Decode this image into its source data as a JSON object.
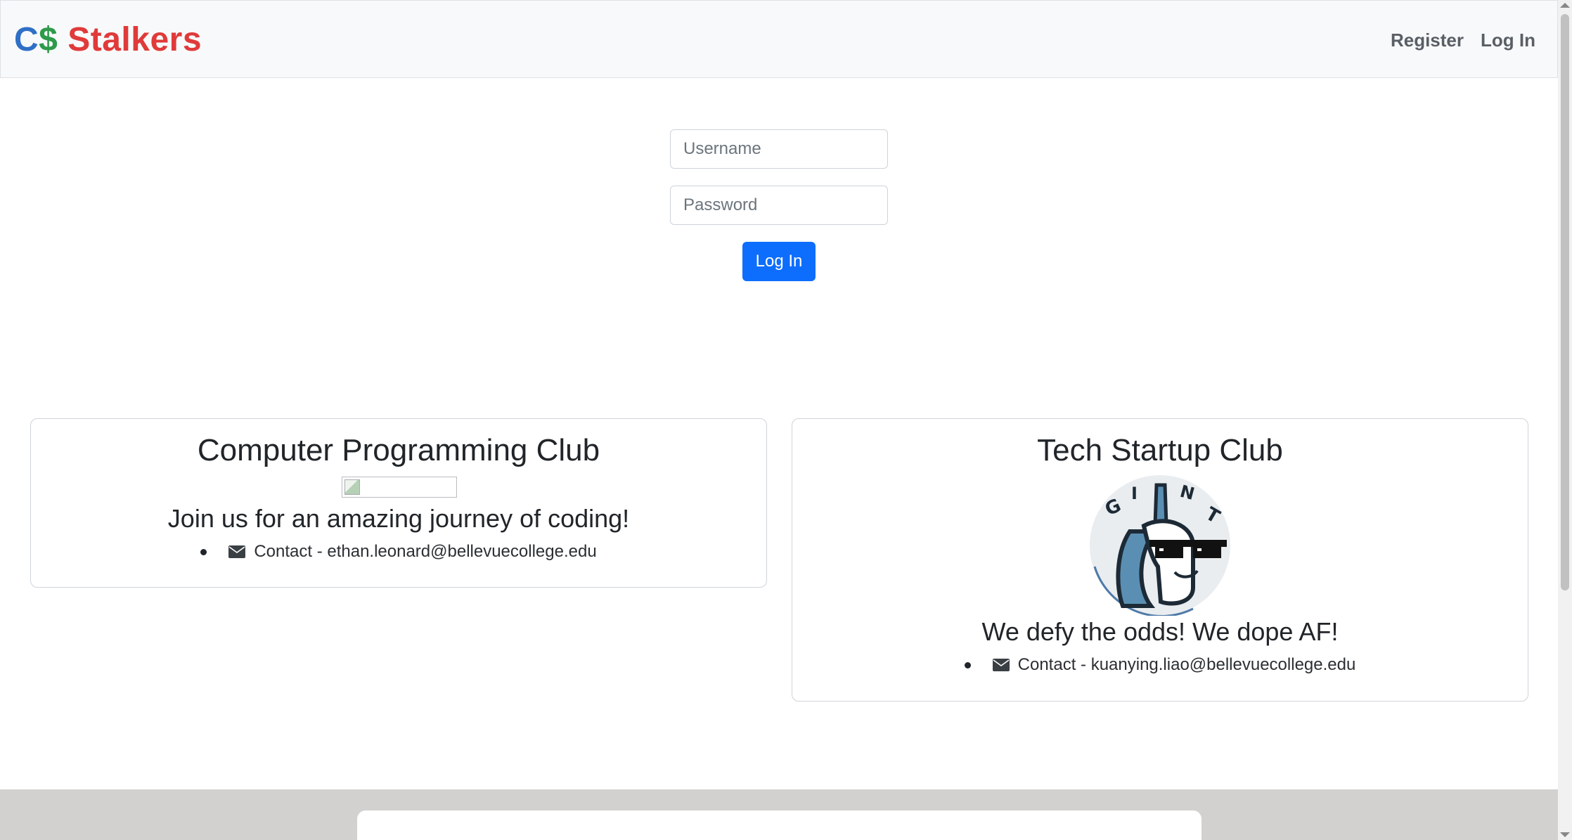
{
  "navbar": {
    "brand_c": "C",
    "brand_dollar": "$",
    "brand_name": " Stalkers",
    "links": [
      "Register",
      "Log In"
    ]
  },
  "login": {
    "username_placeholder": "Username",
    "password_placeholder": "Password",
    "submit_label": "Log In"
  },
  "clubs": [
    {
      "title": "Computer Programming Club",
      "tagline": "Join us for an amazing journey of coding!",
      "contact": "Contact - ethan.leonard@bellevuecollege.edu",
      "icon": "envelope-icon"
    },
    {
      "title": "Tech Startup Club",
      "tagline": "We defy the odds! We dope AF!",
      "contact": "Contact - kuanying.liao@bellevuecollege.edu",
      "icon": "envelope-icon",
      "logo_letters": "GIANT"
    }
  ],
  "colors": {
    "brand_c": "#2f6fc6",
    "brand_dollar": "#2e9a4a",
    "brand_name": "#e03a3a",
    "primary_button": "#0d6efd",
    "footer_band": "#d3d0d0"
  }
}
